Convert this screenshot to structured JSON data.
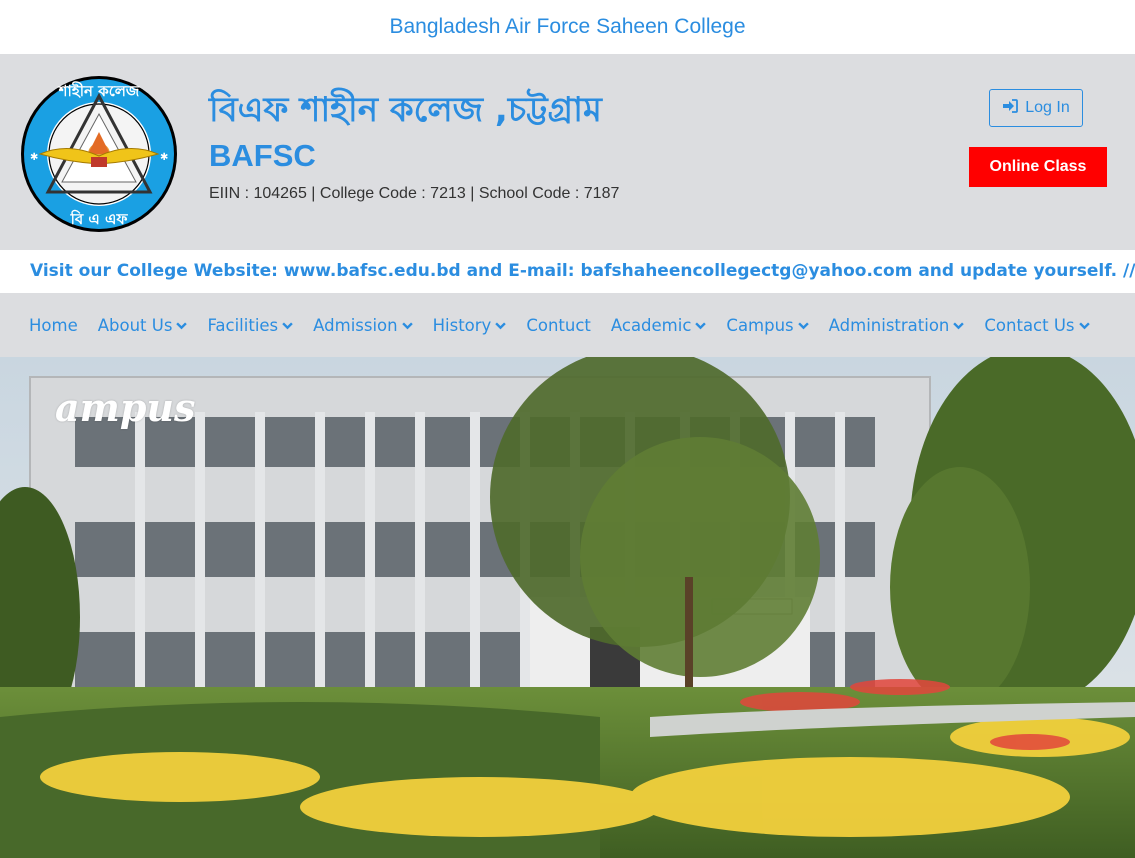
{
  "site": {
    "top_title": "Bangladesh Air Force Saheen College"
  },
  "header": {
    "title_bn": "বিএফ শাহীন কলেজ ,চট্টগ্রাম",
    "title_en": "BAFSC",
    "codes": "EIIN : 104265 | College Code : 7213 | School Code : 7187",
    "login_label": "Log In",
    "online_class_label": "Online Class",
    "logo_ring_text_top": "শাহীন কলেজ",
    "logo_ring_text_bottom": "বি এ এফ"
  },
  "marquee": {
    "text": "Visit our College Website: www.bafsc.edu.bd and E-mail: bafshaheencollegectg@yahoo.com and update yourself. // ***জেলা পর্যায়ে"
  },
  "nav": {
    "items": [
      {
        "label": "Home",
        "dropdown": false
      },
      {
        "label": "About Us",
        "dropdown": true
      },
      {
        "label": "Facilities",
        "dropdown": true
      },
      {
        "label": "Admission",
        "dropdown": true
      },
      {
        "label": "History",
        "dropdown": true
      },
      {
        "label": "Contuct",
        "dropdown": false
      },
      {
        "label": "Academic",
        "dropdown": true
      },
      {
        "label": "Campus",
        "dropdown": true
      },
      {
        "label": "Administration",
        "dropdown": true
      },
      {
        "label": "Contact Us",
        "dropdown": true
      }
    ]
  },
  "hero": {
    "title": "ampus"
  },
  "colors": {
    "accent": "#2b8de0",
    "header_bg": "#dcdde0",
    "online_class": "#ff0000"
  },
  "icons": {
    "login": "sign-in-icon",
    "dropdown": "chevron-down-icon"
  }
}
